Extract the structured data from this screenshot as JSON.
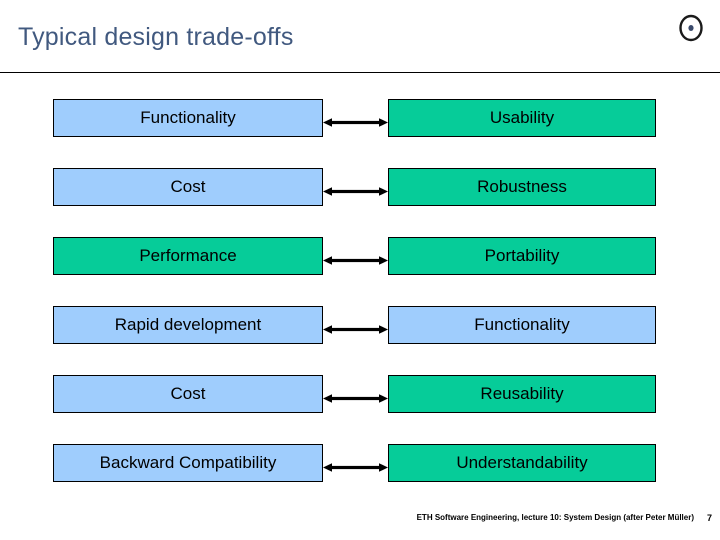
{
  "header": {
    "title": "Typical design trade-offs",
    "logo_icon": "circle-dot-icon",
    "title_color": "#41597f",
    "rule_color": "#000000"
  },
  "colors": {
    "blue": "#9fcdfd",
    "green": "#06cc99",
    "border": "#000000",
    "arrow": "#000000"
  },
  "matrix": {
    "arrow_icon": "double-headed-arrow-icon",
    "rows": [
      {
        "left": {
          "label": "Functionality",
          "color": "blue"
        },
        "right": {
          "label": "Usability",
          "color": "green"
        }
      },
      {
        "left": {
          "label": "Cost",
          "color": "blue"
        },
        "right": {
          "label": "Robustness",
          "color": "green"
        }
      },
      {
        "left": {
          "label": "Performance",
          "color": "green"
        },
        "right": {
          "label": "Portability",
          "color": "green"
        }
      },
      {
        "left": {
          "label": "Rapid development",
          "color": "blue"
        },
        "right": {
          "label": "Functionality",
          "color": "blue"
        }
      },
      {
        "left": {
          "label": "Cost",
          "color": "blue"
        },
        "right": {
          "label": "Reusability",
          "color": "green"
        }
      },
      {
        "left": {
          "label": "Backward Compatibility",
          "color": "blue"
        },
        "right": {
          "label": "Understandability",
          "color": "green"
        }
      }
    ]
  },
  "footer": {
    "text": "ETH Software Engineering, lecture 10: System Design (after Peter Müller)",
    "page_number": "7"
  }
}
